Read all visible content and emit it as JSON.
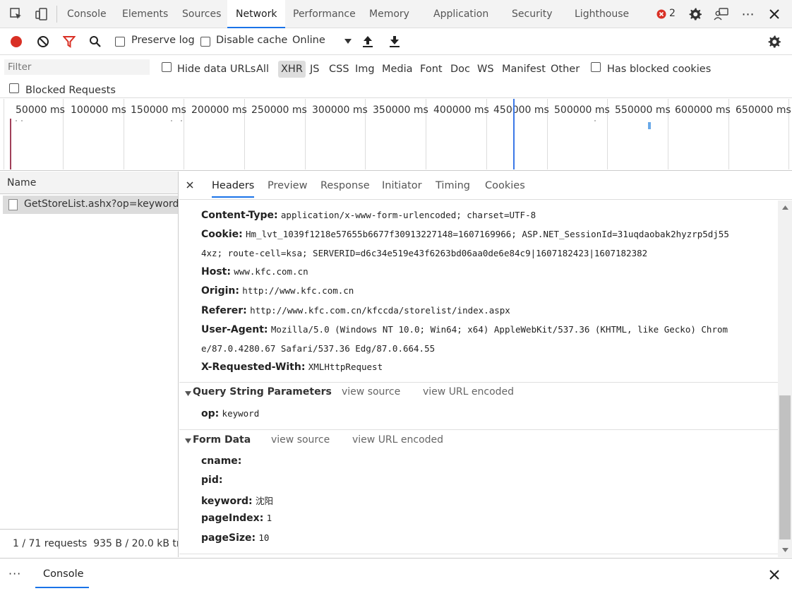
{
  "top_tabs": [
    "Console",
    "Elements",
    "Sources",
    "Network",
    "Performance",
    "Memory",
    "Application",
    "Security",
    "Lighthouse"
  ],
  "error_count": "2",
  "toolbar": {
    "preserve_log": "Preserve log",
    "disable_cache": "Disable cache",
    "throttle": "Online"
  },
  "filter": {
    "placeholder": "Filter",
    "hide_data_urls": "Hide data URLs",
    "types": [
      "All",
      "XHR",
      "JS",
      "CSS",
      "Img",
      "Media",
      "Font",
      "Doc",
      "WS",
      "Manifest",
      "Other"
    ],
    "has_blocked_cookies": "Has blocked cookies",
    "blocked_requests": "Blocked Requests"
  },
  "timeline": {
    "labels": [
      "50000 ms",
      "100000 ms",
      "150000 ms",
      "200000 ms",
      "250000 ms",
      "300000 ms",
      "350000 ms",
      "400000 ms",
      "450000 ms",
      "500000 ms",
      "550000 ms",
      "600000 ms",
      "650000 ms"
    ]
  },
  "name_panel": {
    "header": "Name",
    "requests": [
      "GetStoreList.ashx?op=keyword"
    ],
    "status": "1 / 71 requests  935 B / 20.0 kB tran"
  },
  "detail_tabs": [
    "Headers",
    "Preview",
    "Response",
    "Initiator",
    "Timing",
    "Cookies"
  ],
  "headers": {
    "content_type_key": "Content-Type:",
    "content_type_val": "application/x-www-form-urlencoded; charset=UTF-8",
    "cookie_key": "Cookie:",
    "cookie_val_1": "Hm_lvt_1039f1218e57655b6677f30913227148=1607169966; ASP.NET_SessionId=31uqdaobak2hyzrp5dj55",
    "cookie_val_2": "4xz; route-cell=ksa; SERVERID=d6c34e519e43f6263bd06aa0de6e84c9|1607182423|1607182382",
    "host_key": "Host:",
    "host_val": "www.kfc.com.cn",
    "origin_key": "Origin:",
    "origin_val": "http://www.kfc.com.cn",
    "referer_key": "Referer:",
    "referer_val": "http://www.kfc.com.cn/kfccda/storelist/index.aspx",
    "ua_key": "User-Agent:",
    "ua_val_1": "Mozilla/5.0 (Windows NT 10.0; Win64; x64) AppleWebKit/537.36 (KHTML, like Gecko) Chrom",
    "ua_val_2": "e/87.0.4280.67 Safari/537.36 Edg/87.0.664.55",
    "xrw_key": "X-Requested-With:",
    "xrw_val": "XMLHttpRequest"
  },
  "query_section": {
    "title": "Query String Parameters",
    "view_source": "view source",
    "view_url_encoded": "view URL encoded",
    "op_key": "op:",
    "op_val": "keyword"
  },
  "form_section": {
    "title": "Form Data",
    "view_source": "view source",
    "view_url_encoded": "view URL encoded",
    "cname_key": "cname:",
    "pid_key": "pid:",
    "keyword_key": "keyword:",
    "keyword_val": "沈阳",
    "pageindex_key": "pageIndex:",
    "pageindex_val": "1",
    "pagesize_key": "pageSize:",
    "pagesize_val": "10"
  },
  "drawer": {
    "more": "···",
    "console_tab": "Console"
  }
}
